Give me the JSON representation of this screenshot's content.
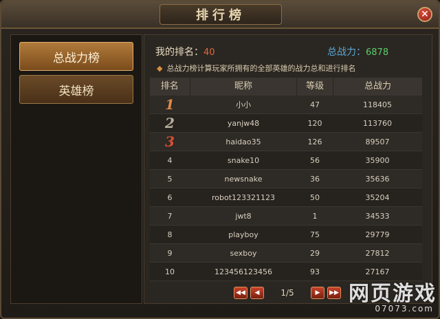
{
  "window": {
    "title": "排行榜"
  },
  "tabs": [
    {
      "label": "总战力榜",
      "active": true
    },
    {
      "label": "英雄榜",
      "active": false
    }
  ],
  "summary": {
    "my_rank_label": "我的排名：",
    "my_rank_value": "40",
    "power_label": "总战力：",
    "power_value": "6878",
    "note": "总战力榜计算玩家所拥有的全部英雄的战力总和进行排名"
  },
  "table": {
    "headers": [
      "排名",
      "昵称",
      "等级",
      "总战力"
    ],
    "rows": [
      {
        "rank": "1",
        "name": "小小",
        "level": "47",
        "power": "118405"
      },
      {
        "rank": "2",
        "name": "yanjw48",
        "level": "120",
        "power": "113760"
      },
      {
        "rank": "3",
        "name": "haidao35",
        "level": "126",
        "power": "89507"
      },
      {
        "rank": "4",
        "name": "snake10",
        "level": "56",
        "power": "35900"
      },
      {
        "rank": "5",
        "name": "newsnake",
        "level": "36",
        "power": "35636"
      },
      {
        "rank": "6",
        "name": "robot123321123",
        "level": "50",
        "power": "35204"
      },
      {
        "rank": "7",
        "name": "jwt8",
        "level": "1",
        "power": "34533"
      },
      {
        "rank": "8",
        "name": "playboy",
        "level": "75",
        "power": "29779"
      },
      {
        "rank": "9",
        "name": "sexboy",
        "level": "29",
        "power": "27812"
      },
      {
        "rank": "10",
        "name": "123456123456",
        "level": "93",
        "power": "27167"
      }
    ]
  },
  "pager": {
    "text": "1/5"
  },
  "watermark": {
    "main": "网页游戏",
    "sub": "07073.com"
  },
  "colors": {
    "accent": "#b07a3a",
    "rank_value": "#e06a3a",
    "power_value": "#5ad06a"
  }
}
